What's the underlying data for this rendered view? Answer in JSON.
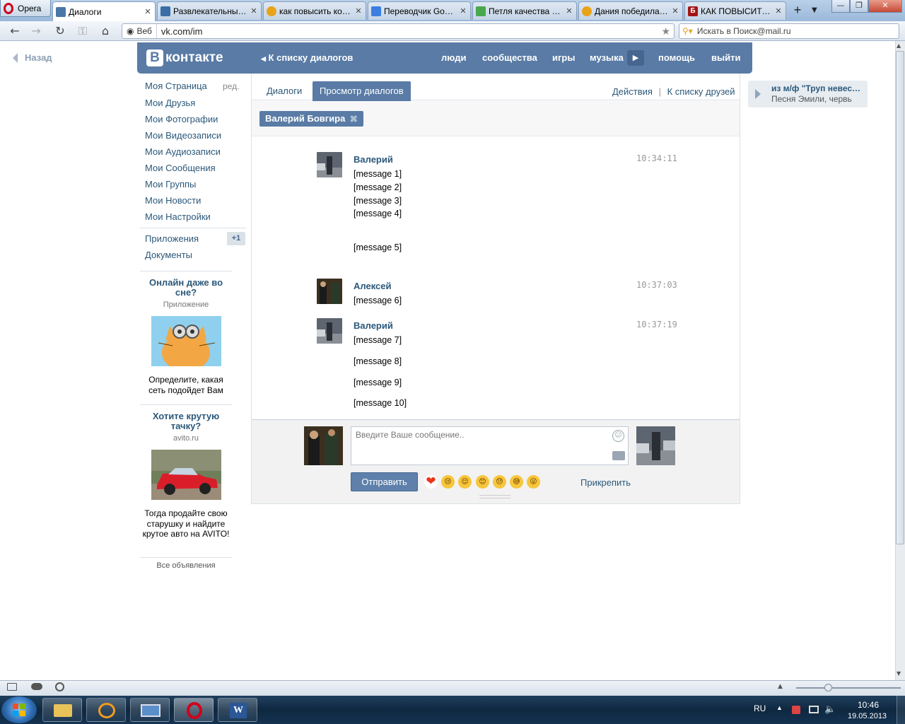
{
  "browser": {
    "menu_label": "Opera",
    "tabs": [
      {
        "label": "Диалоги",
        "icon_color": "#4a76a8",
        "active": true
      },
      {
        "label": "Развлекательный...",
        "icon_color": "#3b6ea5"
      },
      {
        "label": "как повысить кон...",
        "icon_color": "#e8a317"
      },
      {
        "label": "Переводчик Goo...",
        "icon_color": "#3c7de0"
      },
      {
        "label": "Петля качества ст...",
        "icon_color": "#49a84c"
      },
      {
        "label": "Дания победила ...",
        "icon_color": "#e8a317"
      },
      {
        "label": "КАК ПОВЫСИТЬ ...",
        "icon_color": "#a31515"
      }
    ],
    "address": {
      "prefix": "Веб",
      "url": "vk.com/im"
    },
    "search_placeholder": "Искать в Поиск@mail.ru"
  },
  "page": {
    "back_label": "Назад",
    "header": {
      "logo_letter": "В",
      "logo_text": "контакте",
      "back_to_list": "К списку диалогов",
      "nav": [
        "люди",
        "сообщества",
        "игры",
        "музыка",
        "помощь",
        "выйти"
      ]
    },
    "left_menu": {
      "items": [
        "Моя Страница",
        "Мои Друзья",
        "Мои Фотографии",
        "Мои Видеозаписи",
        "Мои Аудиозаписи",
        "Мои Сообщения",
        "Мои Группы",
        "Мои Новости",
        "Мои Настройки"
      ],
      "edit_label": "ред.",
      "extra": [
        "Приложения",
        "Документы"
      ],
      "apps_badge": "+1"
    },
    "ads": [
      {
        "title": "Онлайн даже во сне?",
        "subtitle": "Приложение",
        "text": "Определите, какая сеть подойдет Вам"
      },
      {
        "title": "Хотите крутую тачку?",
        "subtitle": "avito.ru",
        "text": "Тогда продайте свою старушку и найдите крутое авто на AVITO!"
      }
    ],
    "all_ads_label": "Все объявления",
    "tabs": [
      "Диалоги",
      "Просмотр диалогов"
    ],
    "actions": {
      "actions_label": "Действия",
      "separator": "|",
      "friends_label": "К списку друзей"
    },
    "peer": {
      "name": "Валерий Бовгира",
      "close": "✖"
    },
    "messages": [
      {
        "author": "Валерий",
        "time": "10:34:11",
        "lines": [
          "[message 1]",
          "[message 2]",
          "[message 3]",
          "[message 4]"
        ],
        "extra": "[message 5]"
      },
      {
        "author": "Алексей",
        "time": "10:37:03",
        "lines": [
          "[message 6]"
        ]
      },
      {
        "author": "Валерий",
        "time": "10:37:19",
        "lines": [
          "[message 7]",
          "[message 8]",
          "[message 9]",
          "[message 10]"
        ]
      }
    ],
    "composer": {
      "placeholder": "Введите Ваше сообщение..",
      "send_label": "Отправить",
      "attach_label": "Прикрепить",
      "emojis": [
        "❤",
        "😢",
        "😌",
        "😊",
        "😓",
        "😅",
        "😜"
      ]
    },
    "player": {
      "title": "из м/ф \"Труп невесты\"",
      "artist": "Песня Эмили, червь"
    }
  },
  "taskbar": {
    "lang": "RU",
    "time": "10:46",
    "date": "19.05.2013"
  }
}
